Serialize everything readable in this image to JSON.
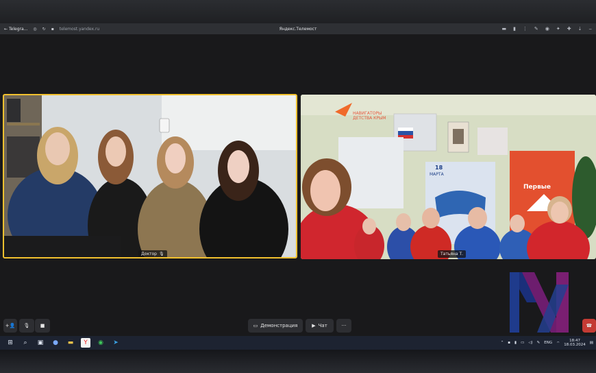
{
  "browser": {
    "back_tab_label": "Telegra...",
    "url": "telemost.yandex.ru",
    "window_title": "Яндекс.Телемост"
  },
  "tiles": [
    {
      "name_label": "Доктор"
    },
    {
      "name_label": "Татьяна Т."
    }
  ],
  "scene_text": {
    "poster_navigators": "НАВИГАТОРЫ ДЕТСТВА КРЫМ",
    "poster_date_day": "18",
    "poster_date_month": "МАРТА",
    "banner_brand": "Первые"
  },
  "controls": {
    "demo_label": "Демонстрация",
    "chat_label": "Чат",
    "more_label": "···"
  },
  "taskbar": {
    "lang": "ENG",
    "time": "18:47",
    "date": "18.03.2024"
  },
  "colors": {
    "active_speaker_border": "#f2c12e",
    "end_call": "#c43b34"
  }
}
